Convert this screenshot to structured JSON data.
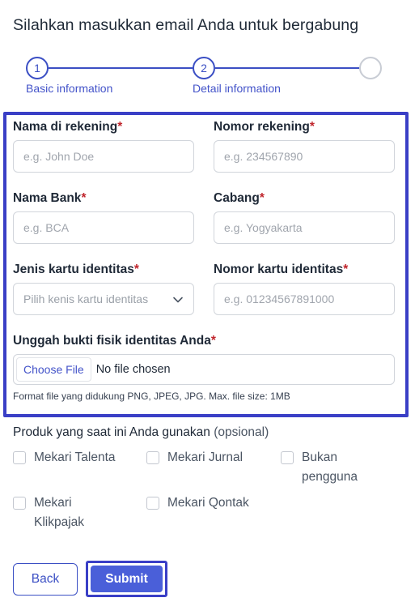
{
  "header": {
    "title": "Silahkan masukkan email Anda untuk bergabung"
  },
  "stepper": {
    "steps": [
      {
        "number": "1",
        "label": "Basic information"
      },
      {
        "number": "2",
        "label": "Detail information"
      },
      {
        "number": "",
        "label": ""
      }
    ]
  },
  "form": {
    "account_name": {
      "label": "Nama di rekening",
      "placeholder": "e.g. John Doe"
    },
    "account_number": {
      "label": "Nomor rekening",
      "placeholder": "e.g. 234567890"
    },
    "bank_name": {
      "label": "Nama Bank",
      "placeholder": "e.g. BCA"
    },
    "branch": {
      "label": "Cabang",
      "placeholder": "e.g. Yogyakarta"
    },
    "id_type": {
      "label": "Jenis kartu identitas",
      "selected": "Pilih kenis kartu identitas"
    },
    "id_number": {
      "label": "Nomor kartu identitas",
      "placeholder": "e.g. 01234567891000"
    },
    "upload": {
      "label": "Unggah bukti fisik identitas Anda",
      "button": "Choose File",
      "status": "No file chosen",
      "hint": "Format file yang didukung PNG, JPEG, JPG. Max. file size: 1MB"
    },
    "required_mark": "*"
  },
  "products": {
    "title": "Produk yang saat ini Anda gunakan",
    "optional": "(opsional)",
    "options": [
      {
        "line1": "Mekari Talenta",
        "line2": ""
      },
      {
        "line1": "Mekari Jurnal",
        "line2": ""
      },
      {
        "line1": "Bukan",
        "line2": "pengguna"
      },
      {
        "line1": "Mekari",
        "line2": "Klikpajak"
      },
      {
        "line1": "Mekari Qontak",
        "line2": ""
      }
    ]
  },
  "actions": {
    "back": "Back",
    "submit": "Submit"
  },
  "colors": {
    "accent": "#3b4fc4",
    "submit_bg": "#4a5fd9",
    "highlight": "#3a3fc6",
    "required": "#c0262d"
  }
}
